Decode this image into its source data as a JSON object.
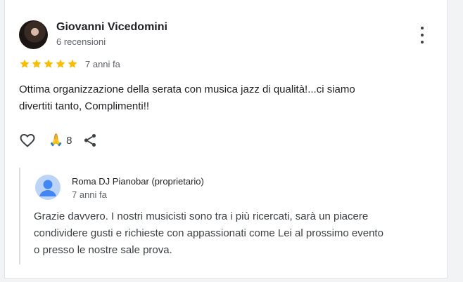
{
  "review": {
    "author": "Giovanni Vicedomini",
    "author_reviews": "6 recensioni",
    "rating": 5,
    "time": "7 anni fa",
    "text_line1": "Ottima organizzazione della serata con musica jazz di qualità!...ci siamo",
    "text_line2": "divertiti tanto, Complimenti!!",
    "reaction_emoji": "🙏",
    "reaction_count": "8"
  },
  "owner_reply": {
    "name": "Roma DJ Pianobar (proprietario)",
    "time": "7 anni fa",
    "text_line1": "Grazie davvero. I nostri musicisti sono tra i più ricercati, sarà un piacere",
    "text_line2": "condividere gusti e richieste con appassionati come Lei al prossimo evento",
    "text_line3": "o presso le nostre sale prova."
  },
  "icons": {
    "star": "star-icon",
    "like": "heart-outline-icon",
    "share": "share-icon",
    "more": "more-vert-icon",
    "owner_avatar": "person-icon"
  },
  "colors": {
    "star": "#fbbc04",
    "text": "#202124",
    "secondary": "#5f6368",
    "reply_border": "#dadce0",
    "owner_avatar_bg": "#bcd4f6",
    "owner_avatar_fg": "#4285f4"
  }
}
